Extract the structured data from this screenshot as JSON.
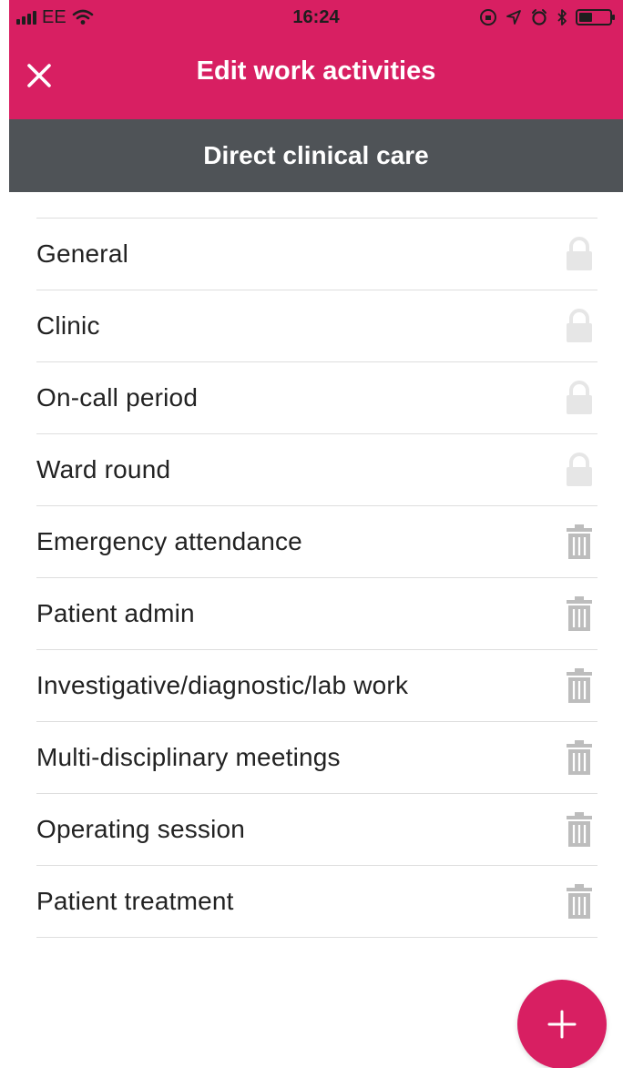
{
  "status_bar": {
    "carrier": "EE",
    "time": "16:24",
    "battery_level": 0.45
  },
  "nav": {
    "title": "Edit work activities",
    "close_icon": "close-icon"
  },
  "section": {
    "title": "Direct clinical care"
  },
  "activities": [
    {
      "label": "General",
      "action_icon": "lock-icon"
    },
    {
      "label": "Clinic",
      "action_icon": "lock-icon"
    },
    {
      "label": "On-call period",
      "action_icon": "lock-icon"
    },
    {
      "label": "Ward round",
      "action_icon": "lock-icon"
    },
    {
      "label": "Emergency attendance",
      "action_icon": "trash-icon"
    },
    {
      "label": "Patient admin",
      "action_icon": "trash-icon"
    },
    {
      "label": "Investigative/diagnostic/lab work",
      "action_icon": "trash-icon"
    },
    {
      "label": "Multi-disciplinary meetings",
      "action_icon": "trash-icon"
    },
    {
      "label": "Operating session",
      "action_icon": "trash-icon"
    },
    {
      "label": "Patient treatment",
      "action_icon": "trash-icon"
    }
  ],
  "fab": {
    "icon": "plus-icon"
  },
  "colors": {
    "brand_pink": "#d81f62",
    "section_gray": "#4f5357",
    "divider": "#dedede",
    "lock_gray": "#e6e6e6",
    "trash_gray": "#bdbdbd"
  }
}
